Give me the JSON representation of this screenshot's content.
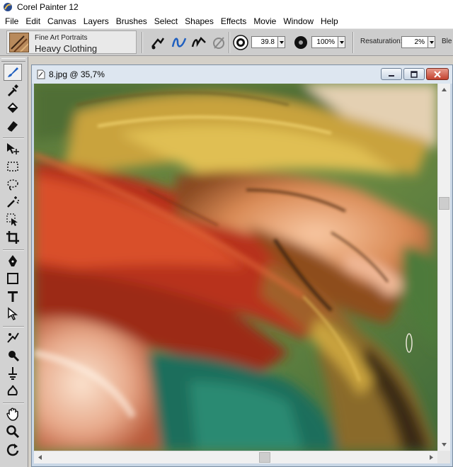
{
  "app": {
    "title": "Corel Painter 12"
  },
  "menu": [
    "File",
    "Edit",
    "Canvas",
    "Layers",
    "Brushes",
    "Select",
    "Shapes",
    "Effects",
    "Movie",
    "Window",
    "Help"
  ],
  "brush": {
    "category": "Fine Art Portraits",
    "variant": "Heavy Clothing"
  },
  "properties": {
    "size_value": "39.8",
    "opacity_value": "100%",
    "resaturation_label": "Resaturation:",
    "resaturation_value": "2%",
    "bleed_label_partial": "Ble"
  },
  "document": {
    "title": "8.jpg @ 35,7%"
  },
  "icons": {
    "toolbox": [
      "brush-icon",
      "dropper-icon",
      "paint-bucket-icon",
      "eraser-icon",
      "layer-adjuster-icon",
      "rect-select-icon",
      "lasso-icon",
      "magic-wand-icon",
      "selection-adjuster-icon",
      "crop-icon",
      "pen-icon",
      "rectangle-shape-icon",
      "text-icon",
      "shape-selection-icon",
      "cloner-icon",
      "rubber-stamp-icon",
      "dodge-icon",
      "burn-icon",
      "grabber-icon",
      "magnifier-icon",
      "rotate-page-icon"
    ]
  },
  "colors": {
    "accent_blue": "#1f5fbf",
    "close_red": "#c3422f"
  }
}
